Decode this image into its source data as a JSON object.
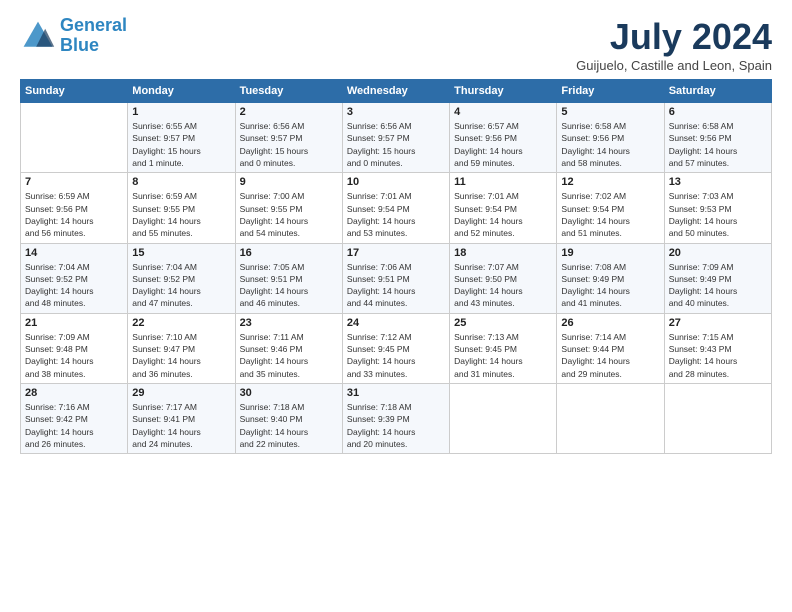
{
  "logo": {
    "line1": "General",
    "line2": "Blue"
  },
  "title": "July 2024",
  "location": "Guijuelo, Castille and Leon, Spain",
  "days_header": [
    "Sunday",
    "Monday",
    "Tuesday",
    "Wednesday",
    "Thursday",
    "Friday",
    "Saturday"
  ],
  "weeks": [
    [
      {
        "day": "",
        "info": ""
      },
      {
        "day": "1",
        "info": "Sunrise: 6:55 AM\nSunset: 9:57 PM\nDaylight: 15 hours\nand 1 minute."
      },
      {
        "day": "2",
        "info": "Sunrise: 6:56 AM\nSunset: 9:57 PM\nDaylight: 15 hours\nand 0 minutes."
      },
      {
        "day": "3",
        "info": "Sunrise: 6:56 AM\nSunset: 9:57 PM\nDaylight: 15 hours\nand 0 minutes."
      },
      {
        "day": "4",
        "info": "Sunrise: 6:57 AM\nSunset: 9:56 PM\nDaylight: 14 hours\nand 59 minutes."
      },
      {
        "day": "5",
        "info": "Sunrise: 6:58 AM\nSunset: 9:56 PM\nDaylight: 14 hours\nand 58 minutes."
      },
      {
        "day": "6",
        "info": "Sunrise: 6:58 AM\nSunset: 9:56 PM\nDaylight: 14 hours\nand 57 minutes."
      }
    ],
    [
      {
        "day": "7",
        "info": "Sunrise: 6:59 AM\nSunset: 9:56 PM\nDaylight: 14 hours\nand 56 minutes."
      },
      {
        "day": "8",
        "info": "Sunrise: 6:59 AM\nSunset: 9:55 PM\nDaylight: 14 hours\nand 55 minutes."
      },
      {
        "day": "9",
        "info": "Sunrise: 7:00 AM\nSunset: 9:55 PM\nDaylight: 14 hours\nand 54 minutes."
      },
      {
        "day": "10",
        "info": "Sunrise: 7:01 AM\nSunset: 9:54 PM\nDaylight: 14 hours\nand 53 minutes."
      },
      {
        "day": "11",
        "info": "Sunrise: 7:01 AM\nSunset: 9:54 PM\nDaylight: 14 hours\nand 52 minutes."
      },
      {
        "day": "12",
        "info": "Sunrise: 7:02 AM\nSunset: 9:54 PM\nDaylight: 14 hours\nand 51 minutes."
      },
      {
        "day": "13",
        "info": "Sunrise: 7:03 AM\nSunset: 9:53 PM\nDaylight: 14 hours\nand 50 minutes."
      }
    ],
    [
      {
        "day": "14",
        "info": "Sunrise: 7:04 AM\nSunset: 9:52 PM\nDaylight: 14 hours\nand 48 minutes."
      },
      {
        "day": "15",
        "info": "Sunrise: 7:04 AM\nSunset: 9:52 PM\nDaylight: 14 hours\nand 47 minutes."
      },
      {
        "day": "16",
        "info": "Sunrise: 7:05 AM\nSunset: 9:51 PM\nDaylight: 14 hours\nand 46 minutes."
      },
      {
        "day": "17",
        "info": "Sunrise: 7:06 AM\nSunset: 9:51 PM\nDaylight: 14 hours\nand 44 minutes."
      },
      {
        "day": "18",
        "info": "Sunrise: 7:07 AM\nSunset: 9:50 PM\nDaylight: 14 hours\nand 43 minutes."
      },
      {
        "day": "19",
        "info": "Sunrise: 7:08 AM\nSunset: 9:49 PM\nDaylight: 14 hours\nand 41 minutes."
      },
      {
        "day": "20",
        "info": "Sunrise: 7:09 AM\nSunset: 9:49 PM\nDaylight: 14 hours\nand 40 minutes."
      }
    ],
    [
      {
        "day": "21",
        "info": "Sunrise: 7:09 AM\nSunset: 9:48 PM\nDaylight: 14 hours\nand 38 minutes."
      },
      {
        "day": "22",
        "info": "Sunrise: 7:10 AM\nSunset: 9:47 PM\nDaylight: 14 hours\nand 36 minutes."
      },
      {
        "day": "23",
        "info": "Sunrise: 7:11 AM\nSunset: 9:46 PM\nDaylight: 14 hours\nand 35 minutes."
      },
      {
        "day": "24",
        "info": "Sunrise: 7:12 AM\nSunset: 9:45 PM\nDaylight: 14 hours\nand 33 minutes."
      },
      {
        "day": "25",
        "info": "Sunrise: 7:13 AM\nSunset: 9:45 PM\nDaylight: 14 hours\nand 31 minutes."
      },
      {
        "day": "26",
        "info": "Sunrise: 7:14 AM\nSunset: 9:44 PM\nDaylight: 14 hours\nand 29 minutes."
      },
      {
        "day": "27",
        "info": "Sunrise: 7:15 AM\nSunset: 9:43 PM\nDaylight: 14 hours\nand 28 minutes."
      }
    ],
    [
      {
        "day": "28",
        "info": "Sunrise: 7:16 AM\nSunset: 9:42 PM\nDaylight: 14 hours\nand 26 minutes."
      },
      {
        "day": "29",
        "info": "Sunrise: 7:17 AM\nSunset: 9:41 PM\nDaylight: 14 hours\nand 24 minutes."
      },
      {
        "day": "30",
        "info": "Sunrise: 7:18 AM\nSunset: 9:40 PM\nDaylight: 14 hours\nand 22 minutes."
      },
      {
        "day": "31",
        "info": "Sunrise: 7:18 AM\nSunset: 9:39 PM\nDaylight: 14 hours\nand 20 minutes."
      },
      {
        "day": "",
        "info": ""
      },
      {
        "day": "",
        "info": ""
      },
      {
        "day": "",
        "info": ""
      }
    ]
  ]
}
